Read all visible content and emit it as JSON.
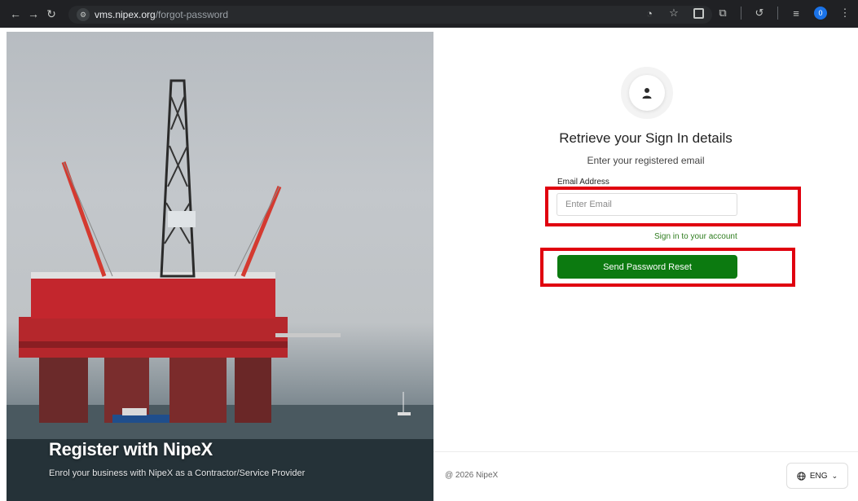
{
  "browser": {
    "url_domain": "vms.nipex.org",
    "url_path": "/forgot-password",
    "profile_count": "0"
  },
  "hero": {
    "title": "Register with NipeX",
    "subtitle": "Enrol your business with NipeX as a Contractor/Service Provider",
    "image_icon": "offshore-rig-photo"
  },
  "form": {
    "title": "Retrieve your Sign In details",
    "subtitle": "Enter your registered email",
    "email_label": "Email Address",
    "email_value": "",
    "email_placeholder": "Enter Email",
    "signin_link": "Sign in to your account",
    "submit_label": "Send Password Reset"
  },
  "footer": {
    "copyright": "@ 2026 NipeX",
    "language": "ENG"
  },
  "colors": {
    "primary_green": "#0c7a10",
    "link_green": "#2f7d1f",
    "highlight_red": "#e0000f"
  }
}
